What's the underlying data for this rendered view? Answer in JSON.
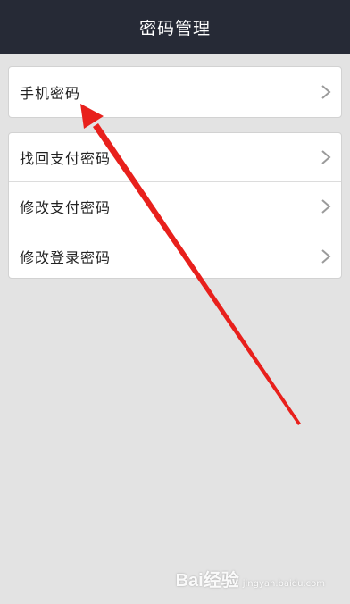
{
  "header": {
    "title": "密码管理"
  },
  "groups": [
    {
      "items": [
        {
          "label": "手机密码"
        }
      ]
    },
    {
      "items": [
        {
          "label": "找回支付密码"
        },
        {
          "label": "修改支付密码"
        },
        {
          "label": "修改登录密码"
        }
      ]
    }
  ],
  "icons": {
    "row_chevron": "chevron-right-icon"
  },
  "watermark": {
    "text": "Bai经验",
    "sub": "jingyan.baidu.com"
  },
  "colors": {
    "header_bg": "#262a36",
    "page_bg": "#e3e3e3",
    "annotation_arrow": "#e8201c"
  }
}
